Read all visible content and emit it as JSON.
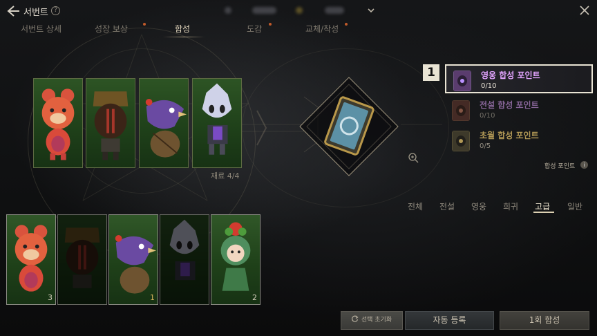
{
  "header": {
    "title": "서번트",
    "help_icon": "?"
  },
  "tabs": [
    {
      "label": "서번트 상세",
      "active": false,
      "dot": false
    },
    {
      "label": "성장 보상",
      "active": false,
      "dot": true
    },
    {
      "label": "합성",
      "active": true,
      "dot": false
    },
    {
      "label": "도감",
      "active": false,
      "dot": true
    },
    {
      "label": "교체/착성",
      "active": false,
      "dot": true
    }
  ],
  "materials": {
    "label": "재료 4/4",
    "cards": [
      {
        "name": "teddy-bear-servant"
      },
      {
        "name": "armored-knight-servant"
      },
      {
        "name": "purple-bird-servant"
      },
      {
        "name": "ghost-servant"
      }
    ]
  },
  "points_panel": {
    "badge": "1",
    "rows": [
      {
        "name": "영웅 합성 포인트",
        "value": "0/10",
        "color": "#e3a4ff",
        "active": true
      },
      {
        "name": "전설 합성 포인트",
        "value": "0/10",
        "color": "#e3a4ff",
        "active": false
      },
      {
        "name": "초월 합성 포인트",
        "value": "0/5",
        "color": "#e6c46a",
        "active": false
      }
    ],
    "link_label": "합성 포인트",
    "info_icon": "i"
  },
  "filters": [
    {
      "label": "전체",
      "active": false
    },
    {
      "label": "전설",
      "active": false
    },
    {
      "label": "영웅",
      "active": false
    },
    {
      "label": "희귀",
      "active": false
    },
    {
      "label": "고급",
      "active": true
    },
    {
      "label": "일반",
      "active": false
    }
  ],
  "inventory": [
    {
      "name": "teddy-bear-servant",
      "count": "3",
      "dim": false,
      "count_gold": false
    },
    {
      "name": "armored-knight-servant",
      "count": "",
      "dim": true,
      "count_gold": false
    },
    {
      "name": "purple-bird-servant",
      "count": "1",
      "dim": false,
      "count_gold": true
    },
    {
      "name": "ghost-servant",
      "count": "",
      "dim": true,
      "count_gold": false
    },
    {
      "name": "flower-girl-servant",
      "count": "2",
      "dim": false,
      "count_gold": false
    }
  ],
  "buttons": {
    "reset": "선택 초기화",
    "auto": "자동 등록",
    "synth": "1회 합성"
  },
  "colors": {
    "accent": "#e9e4d4",
    "tab_dot": "#c05a2a",
    "card_green": "#2d5424"
  }
}
